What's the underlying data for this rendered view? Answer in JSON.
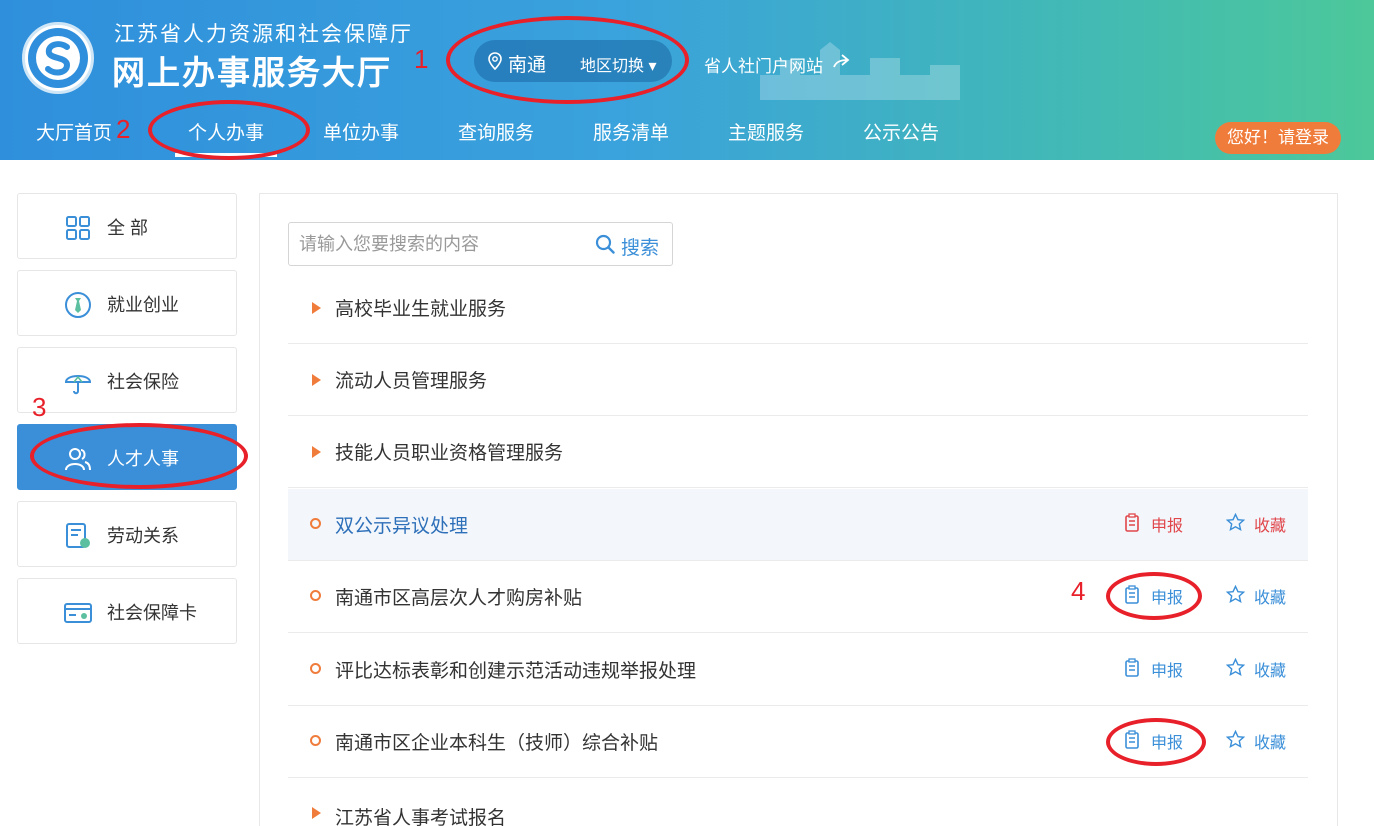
{
  "header": {
    "org_name": "江苏省人力资源和社会保障厅",
    "hall_name": "网上办事服务大厅",
    "city": "南通",
    "switch_label": "地区切换 ▾",
    "portal_link": "省人社门户网站",
    "login": "您好！请登录"
  },
  "nav": {
    "items": [
      "大厅首页",
      "个人办事",
      "单位办事",
      "查询服务",
      "服务清单",
      "主题服务",
      "公示公告"
    ],
    "active": "个人办事"
  },
  "sidebar": {
    "items": [
      {
        "label": "全 部",
        "icon": "grid-icon"
      },
      {
        "label": "就业创业",
        "icon": "tie-icon"
      },
      {
        "label": "社会保险",
        "icon": "umbrella-icon"
      },
      {
        "label": "人才人事",
        "icon": "people-icon"
      },
      {
        "label": "劳动关系",
        "icon": "document-icon"
      },
      {
        "label": "社会保障卡",
        "icon": "card-icon"
      }
    ],
    "active": "人才人事"
  },
  "search": {
    "placeholder": "请输入您要搜索的内容",
    "button": "搜索"
  },
  "services": [
    {
      "label": "高校毕业生就业服务",
      "type": "category"
    },
    {
      "label": "流动人员管理服务",
      "type": "category"
    },
    {
      "label": "技能人员职业资格管理服务",
      "type": "category"
    },
    {
      "label": "双公示异议处理",
      "type": "item",
      "apply": "申报",
      "favorite": "收藏",
      "highlighted": true
    },
    {
      "label": "南通市区高层次人才购房补贴",
      "type": "item",
      "apply": "申报",
      "favorite": "收藏"
    },
    {
      "label": "评比达标表彰和创建示范活动违规举报处理",
      "type": "item",
      "apply": "申报",
      "favorite": "收藏"
    },
    {
      "label": "南通市区企业本科生（技师）综合补贴",
      "type": "item",
      "apply": "申报",
      "favorite": "收藏"
    },
    {
      "label": "江苏省人事考试报名",
      "type": "category"
    }
  ],
  "annotations": [
    "1",
    "2",
    "3",
    "4"
  ],
  "colors": {
    "primary": "#3b8fd8",
    "accent": "#f07c3c",
    "annotation": "#e8202a"
  }
}
